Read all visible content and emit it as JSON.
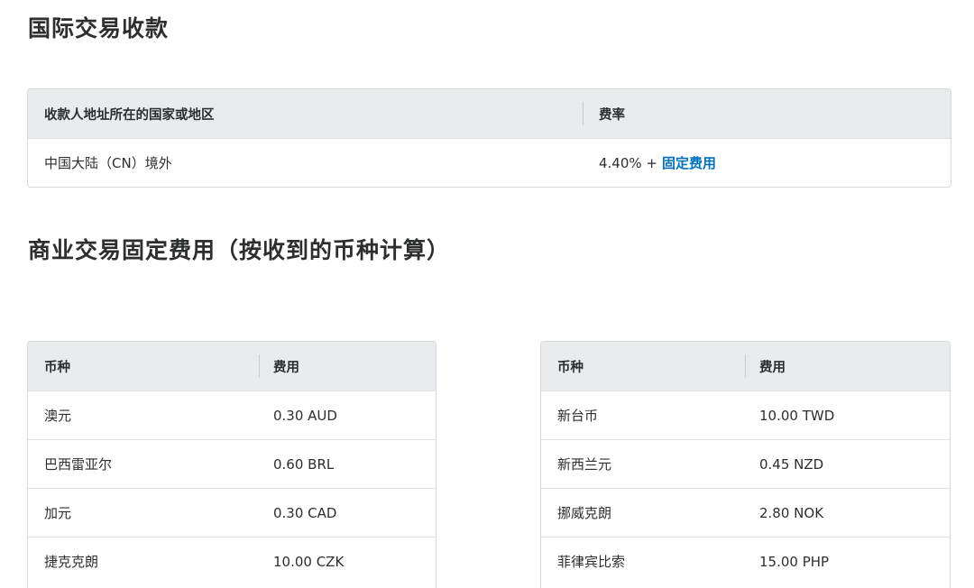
{
  "intl": {
    "title": "国际交易收款",
    "headers": [
      "收款人地址所在的国家或地区",
      "费率"
    ],
    "rows": [
      {
        "region": "中国大陆（CN）境外",
        "rate": "4.40% +",
        "link": "固定费用"
      }
    ]
  },
  "fixed": {
    "title": "商业交易固定费用（按收到的币种计算）",
    "left": {
      "headers": [
        "币种",
        "费用"
      ],
      "rows": [
        {
          "currency": "澳元",
          "fee": "0.30 AUD"
        },
        {
          "currency": "巴西雷亚尔",
          "fee": "0.60 BRL"
        },
        {
          "currency": "加元",
          "fee": "0.30 CAD"
        },
        {
          "currency": "捷克克朗",
          "fee": "10.00 CZK"
        }
      ]
    },
    "right": {
      "headers": [
        "币种",
        "费用"
      ],
      "rows": [
        {
          "currency": "新台币",
          "fee": "10.00 TWD"
        },
        {
          "currency": "新西兰元",
          "fee": "0.45 NZD"
        },
        {
          "currency": "挪威克朗",
          "fee": "2.80 NOK"
        },
        {
          "currency": "菲律宾比索",
          "fee": "15.00 PHP"
        }
      ]
    }
  }
}
